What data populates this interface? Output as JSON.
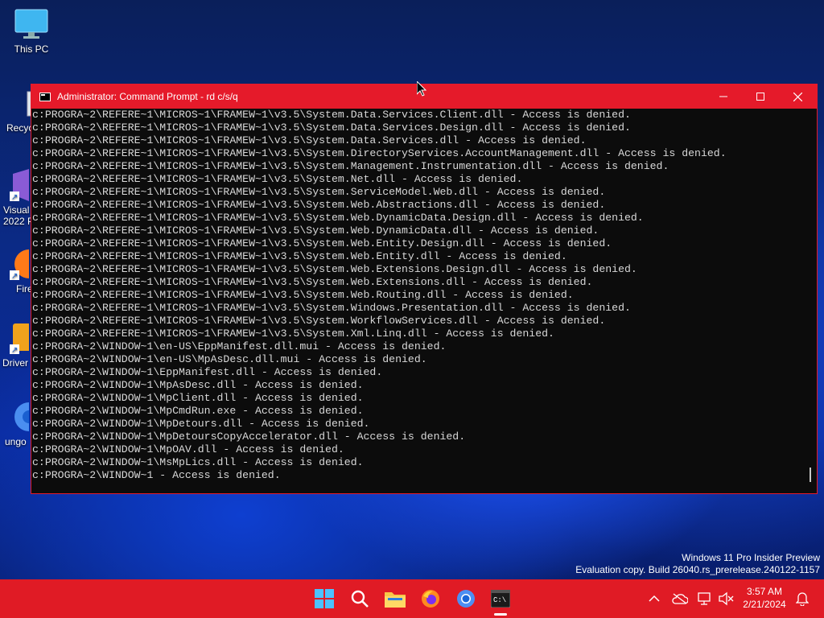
{
  "desktop": {
    "icons": [
      {
        "label": "This PC"
      },
      {
        "label": "Recyc"
      },
      {
        "label": "Visual\n2022 P"
      },
      {
        "label": "Fire"
      },
      {
        "label": "Driver"
      },
      {
        "label": "ungo"
      }
    ]
  },
  "window": {
    "title": "Administrator: Command Prompt - rd  c/s/q",
    "minimize_icon": "minimize-icon",
    "maximize_icon": "maximize-icon",
    "close_icon": "close-icon"
  },
  "console": {
    "lines": [
      "c:PROGRA~2\\REFERE~1\\MICROS~1\\FRAMEW~1\\v3.5\\System.Data.Services.Client.dll - Access is denied.",
      "c:PROGRA~2\\REFERE~1\\MICROS~1\\FRAMEW~1\\v3.5\\System.Data.Services.Design.dll - Access is denied.",
      "c:PROGRA~2\\REFERE~1\\MICROS~1\\FRAMEW~1\\v3.5\\System.Data.Services.dll - Access is denied.",
      "c:PROGRA~2\\REFERE~1\\MICROS~1\\FRAMEW~1\\v3.5\\System.DirectoryServices.AccountManagement.dll - Access is denied.",
      "c:PROGRA~2\\REFERE~1\\MICROS~1\\FRAMEW~1\\v3.5\\System.Management.Instrumentation.dll - Access is denied.",
      "c:PROGRA~2\\REFERE~1\\MICROS~1\\FRAMEW~1\\v3.5\\System.Net.dll - Access is denied.",
      "c:PROGRA~2\\REFERE~1\\MICROS~1\\FRAMEW~1\\v3.5\\System.ServiceModel.Web.dll - Access is denied.",
      "c:PROGRA~2\\REFERE~1\\MICROS~1\\FRAMEW~1\\v3.5\\System.Web.Abstractions.dll - Access is denied.",
      "c:PROGRA~2\\REFERE~1\\MICROS~1\\FRAMEW~1\\v3.5\\System.Web.DynamicData.Design.dll - Access is denied.",
      "c:PROGRA~2\\REFERE~1\\MICROS~1\\FRAMEW~1\\v3.5\\System.Web.DynamicData.dll - Access is denied.",
      "c:PROGRA~2\\REFERE~1\\MICROS~1\\FRAMEW~1\\v3.5\\System.Web.Entity.Design.dll - Access is denied.",
      "c:PROGRA~2\\REFERE~1\\MICROS~1\\FRAMEW~1\\v3.5\\System.Web.Entity.dll - Access is denied.",
      "c:PROGRA~2\\REFERE~1\\MICROS~1\\FRAMEW~1\\v3.5\\System.Web.Extensions.Design.dll - Access is denied.",
      "c:PROGRA~2\\REFERE~1\\MICROS~1\\FRAMEW~1\\v3.5\\System.Web.Extensions.dll - Access is denied.",
      "c:PROGRA~2\\REFERE~1\\MICROS~1\\FRAMEW~1\\v3.5\\System.Web.Routing.dll - Access is denied.",
      "c:PROGRA~2\\REFERE~1\\MICROS~1\\FRAMEW~1\\v3.5\\System.Windows.Presentation.dll - Access is denied.",
      "c:PROGRA~2\\REFERE~1\\MICROS~1\\FRAMEW~1\\v3.5\\System.WorkflowServices.dll - Access is denied.",
      "c:PROGRA~2\\REFERE~1\\MICROS~1\\FRAMEW~1\\v3.5\\System.Xml.Linq.dll - Access is denied.",
      "c:PROGRA~2\\WINDOW~1\\en-US\\EppManifest.dll.mui - Access is denied.",
      "c:PROGRA~2\\WINDOW~1\\en-US\\MpAsDesc.dll.mui - Access is denied.",
      "c:PROGRA~2\\WINDOW~1\\EppManifest.dll - Access is denied.",
      "c:PROGRA~2\\WINDOW~1\\MpAsDesc.dll - Access is denied.",
      "c:PROGRA~2\\WINDOW~1\\MpClient.dll - Access is denied.",
      "c:PROGRA~2\\WINDOW~1\\MpCmdRun.exe - Access is denied.",
      "c:PROGRA~2\\WINDOW~1\\MpDetours.dll - Access is denied.",
      "c:PROGRA~2\\WINDOW~1\\MpDetoursCopyAccelerator.dll - Access is denied.",
      "c:PROGRA~2\\WINDOW~1\\MpOAV.dll - Access is denied.",
      "c:PROGRA~2\\WINDOW~1\\MsMpLics.dll - Access is denied.",
      "c:PROGRA~2\\WINDOW~1 - Access is denied."
    ]
  },
  "watermark": {
    "line1": "Windows 11 Pro Insider Preview",
    "line2": "Evaluation copy. Build 26040.rs_prerelease.240122-1157"
  },
  "taskbar": {
    "icons": [
      "start-icon",
      "search-icon",
      "file-explorer-icon",
      "firefox-icon",
      "chrome-icon",
      "terminal-icon"
    ],
    "tray": {
      "time": "3:57 AM",
      "date": "2/21/2024"
    }
  },
  "colors": {
    "accent": "#e51a2a",
    "console_bg": "#0c0c0c",
    "console_text": "#d8d8d8"
  }
}
